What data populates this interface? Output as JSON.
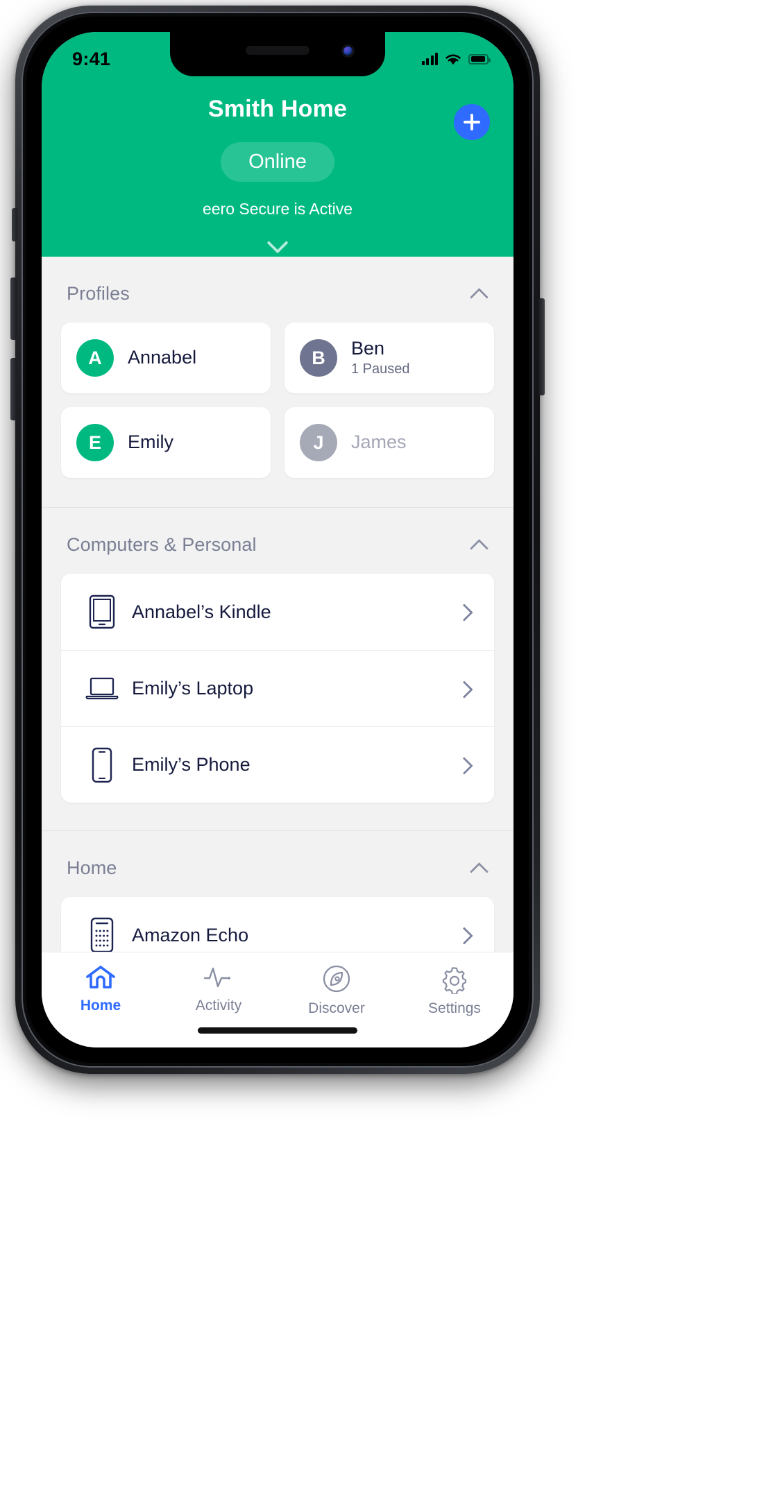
{
  "status_bar": {
    "time": "9:41",
    "cellular_icon": "cellular-bars-icon",
    "wifi_icon": "wifi-icon",
    "battery_icon": "battery-full-icon"
  },
  "header": {
    "title": "Smith Home",
    "status_pill": "Online",
    "secure_text": "eero Secure is Active",
    "add_button_icon": "plus-icon",
    "expand_icon": "chevron-down-icon",
    "background_color": "#00b981",
    "add_button_color": "#2f6bff"
  },
  "sections": [
    {
      "title": "Profiles",
      "collapse_icon": "chevron-up-icon",
      "profiles": [
        {
          "initial": "A",
          "name": "Annabel",
          "sub": "",
          "avatar_color": "#00b981",
          "state": "active"
        },
        {
          "initial": "B",
          "name": "Ben",
          "sub": "1 Paused",
          "avatar_color": "#6f7490",
          "state": "paused"
        },
        {
          "initial": "E",
          "name": "Emily",
          "sub": "",
          "avatar_color": "#00b981",
          "state": "active"
        },
        {
          "initial": "J",
          "name": "James",
          "sub": "",
          "avatar_color": "#a6a9b6",
          "state": "offline"
        }
      ]
    },
    {
      "title": "Computers & Personal",
      "collapse_icon": "chevron-up-icon",
      "devices": [
        {
          "name": "Annabel’s Kindle",
          "icon": "tablet-icon",
          "chevron": "chevron-right-icon"
        },
        {
          "name": "Emily’s Laptop",
          "icon": "laptop-icon",
          "chevron": "chevron-right-icon"
        },
        {
          "name": "Emily’s Phone",
          "icon": "phone-icon",
          "chevron": "chevron-right-icon"
        }
      ]
    },
    {
      "title": "Home",
      "collapse_icon": "chevron-up-icon",
      "devices": [
        {
          "name": "Amazon Echo",
          "icon": "smart-speaker-icon",
          "chevron": "chevron-right-icon"
        }
      ]
    }
  ],
  "tabs": [
    {
      "label": "Home",
      "icon": "house-icon",
      "active": true
    },
    {
      "label": "Activity",
      "icon": "pulse-icon",
      "active": false
    },
    {
      "label": "Discover",
      "icon": "compass-icon",
      "active": false
    },
    {
      "label": "Settings",
      "icon": "gear-icon",
      "active": false
    }
  ],
  "colors": {
    "brand_green": "#00b981",
    "accent_blue": "#2f6bff",
    "text_dark": "#151a3d",
    "text_muted": "#7a7f94"
  }
}
